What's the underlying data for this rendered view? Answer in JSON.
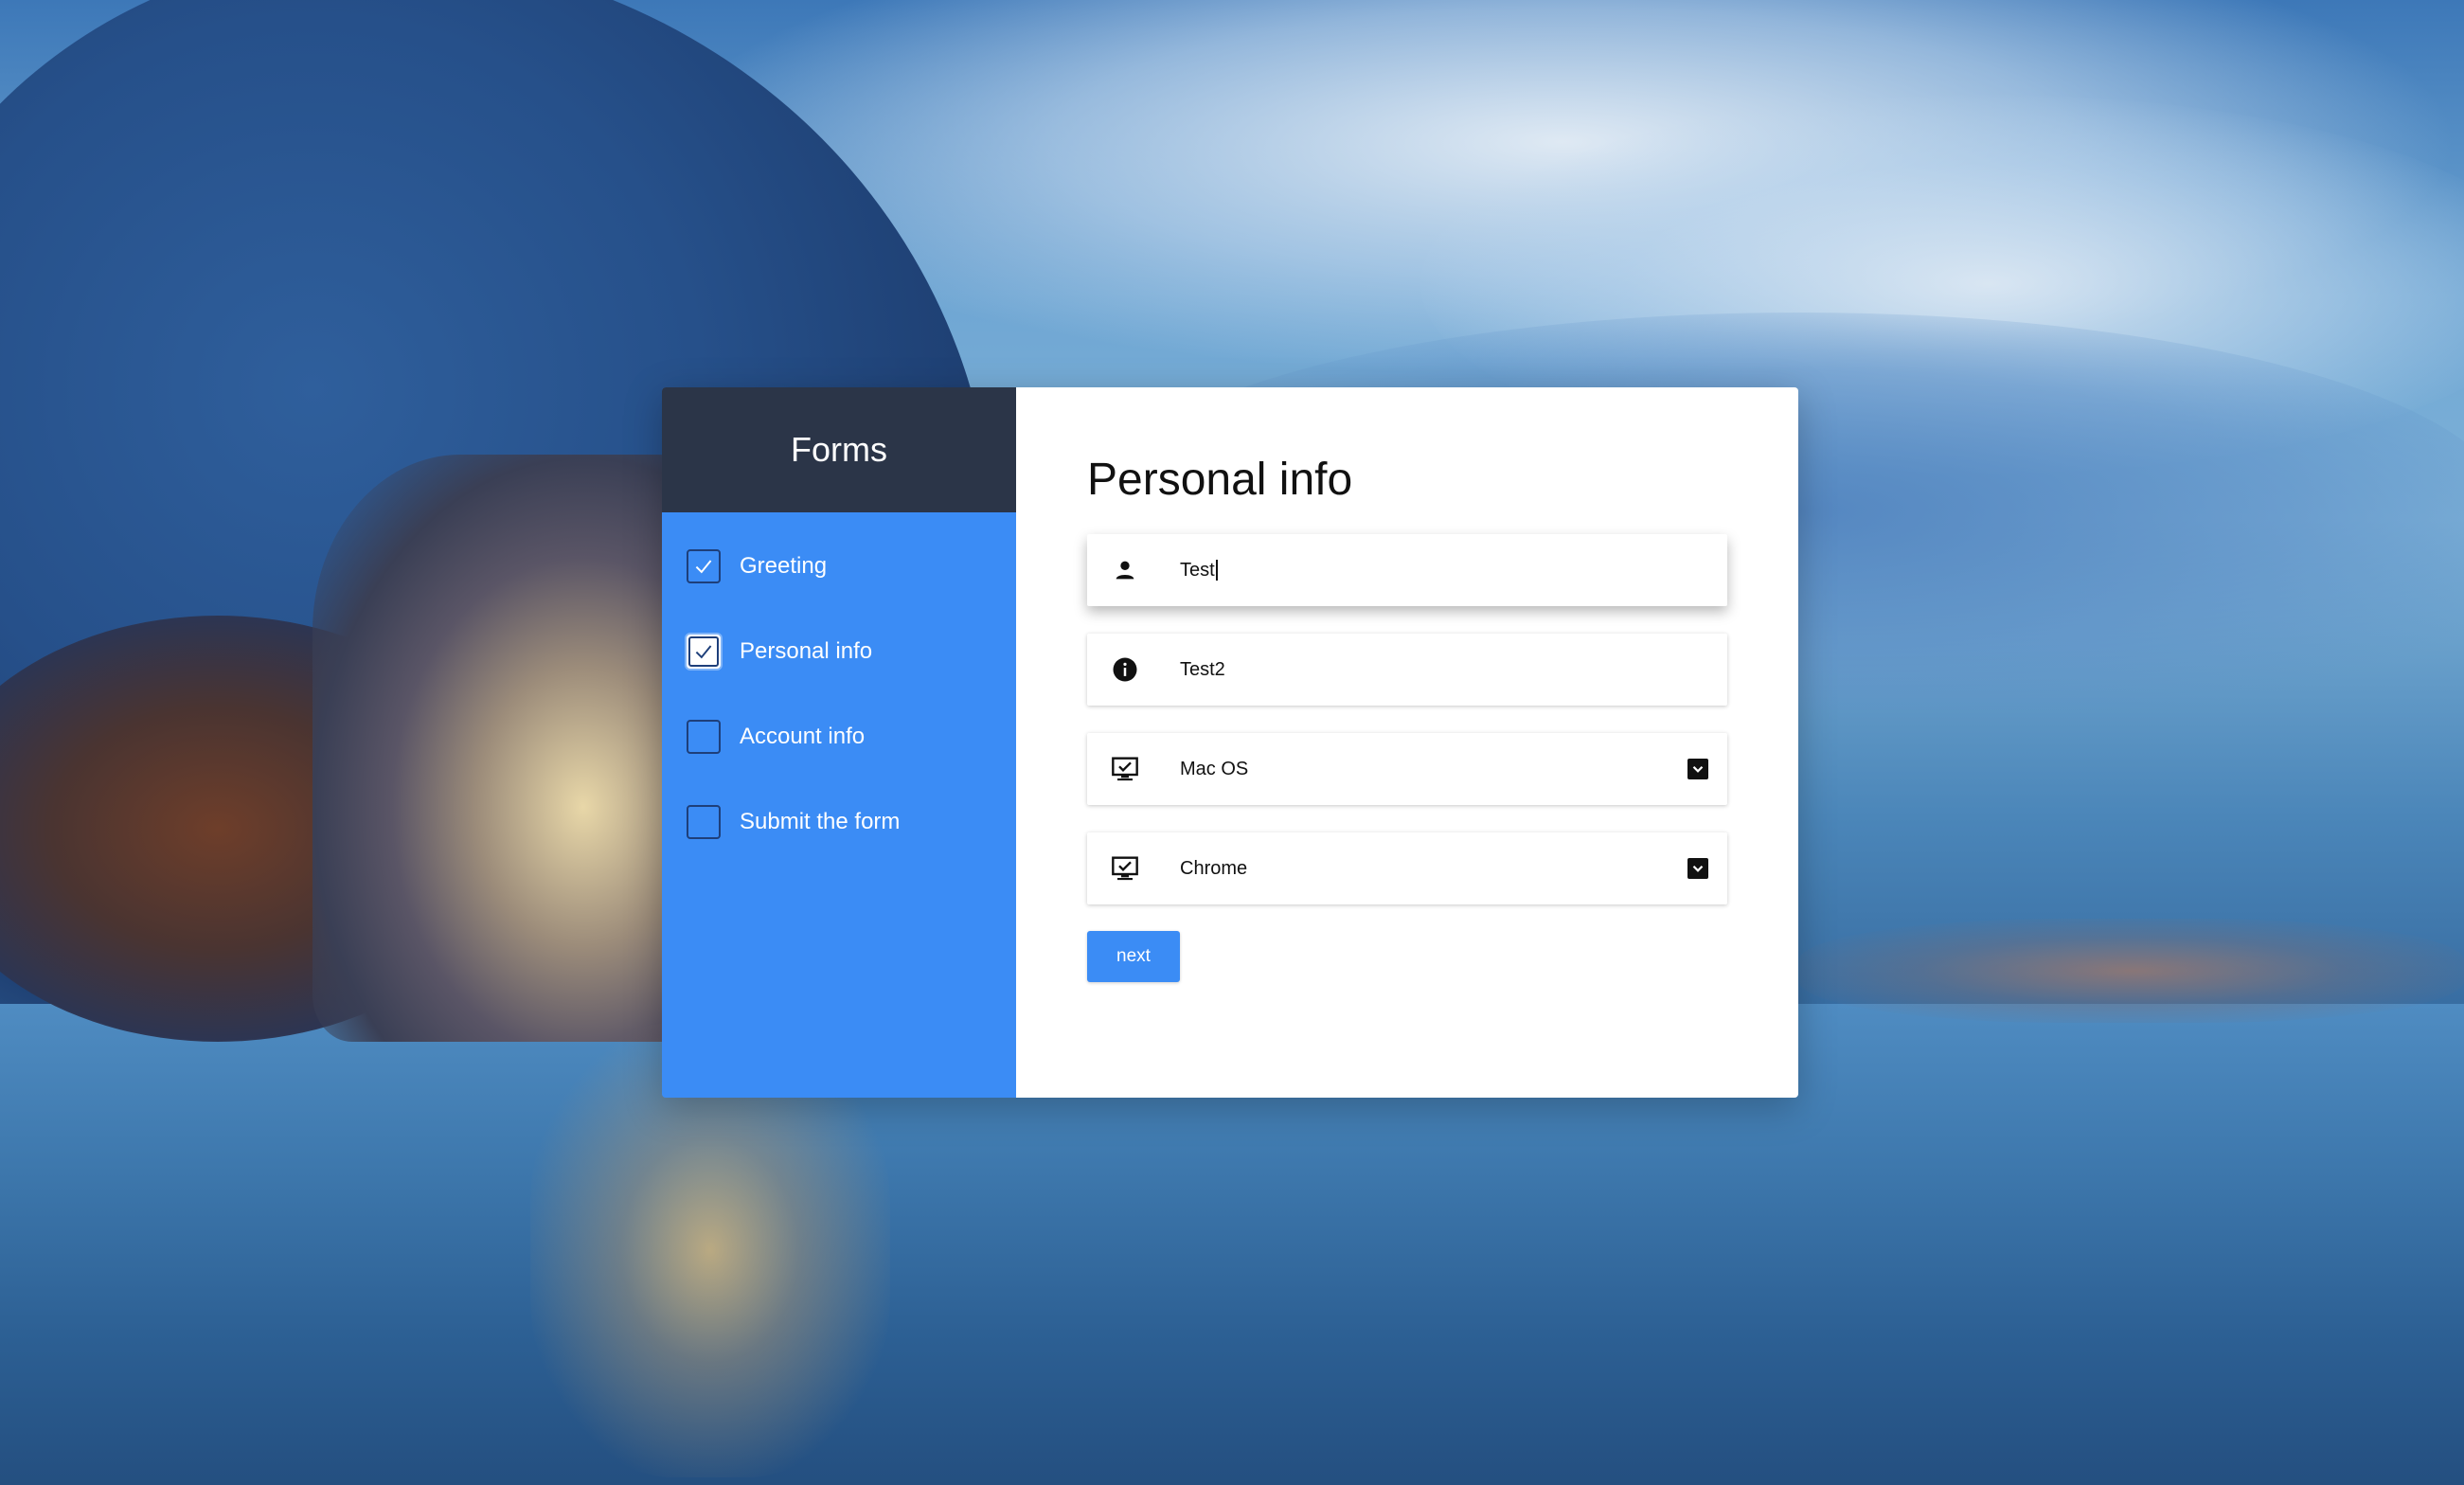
{
  "sidebar": {
    "title": "Forms",
    "steps": [
      {
        "label": "Greeting",
        "checked": true,
        "active": false
      },
      {
        "label": "Personal info",
        "checked": true,
        "active": true
      },
      {
        "label": "Account info",
        "checked": false,
        "active": false
      },
      {
        "label": "Submit the form",
        "checked": false,
        "active": false
      }
    ]
  },
  "main": {
    "title": "Personal info",
    "fields": {
      "name": {
        "value": "Test",
        "icon": "person-icon"
      },
      "info": {
        "value": "Test2",
        "icon": "info-icon"
      },
      "os": {
        "value": "Mac OS",
        "icon": "monitor-check-icon"
      },
      "browser": {
        "value": "Chrome",
        "icon": "monitor-check-icon"
      }
    },
    "next_label": "next"
  },
  "colors": {
    "sidebar_blue": "#3b8cf5",
    "sidebar_header": "#2b3548",
    "button_blue": "#3b8cf5"
  }
}
